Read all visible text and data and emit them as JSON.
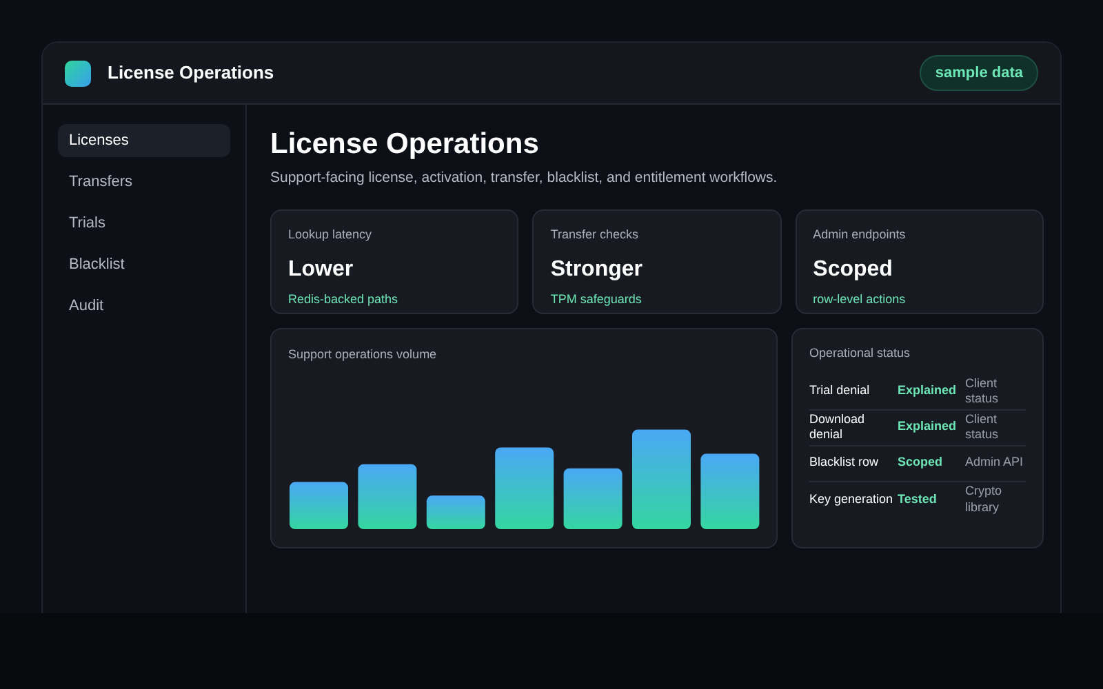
{
  "app": {
    "title": "License Operations",
    "badge": "sample data"
  },
  "sidebar": {
    "items": [
      {
        "label": "Licenses",
        "selected": true
      },
      {
        "label": "Transfers",
        "selected": false
      },
      {
        "label": "Trials",
        "selected": false
      },
      {
        "label": "Blacklist",
        "selected": false
      },
      {
        "label": "Audit",
        "selected": false
      }
    ]
  },
  "page": {
    "title": "License Operations",
    "subtitle": "Support-facing license, activation, transfer, blacklist, and entitlement workflows."
  },
  "stats": [
    {
      "label": "Lookup latency",
      "value": "Lower",
      "note": "Redis-backed paths"
    },
    {
      "label": "Transfer checks",
      "value": "Stronger",
      "note": "TPM safeguards"
    },
    {
      "label": "Admin endpoints",
      "value": "Scoped",
      "note": "row-level actions"
    }
  ],
  "volume_panel": {
    "title": "Support operations volume"
  },
  "status_panel": {
    "title": "Operational status",
    "rows": [
      {
        "item": "Trial denial",
        "status": "Explained",
        "source": "Client status"
      },
      {
        "item": "Download denial",
        "status": "Explained",
        "source": "Client status"
      },
      {
        "item": "Blacklist row",
        "status": "Scoped",
        "source": "Admin API"
      },
      {
        "item": "Key generation",
        "status": "Tested",
        "source": "Crypto library"
      }
    ]
  }
}
